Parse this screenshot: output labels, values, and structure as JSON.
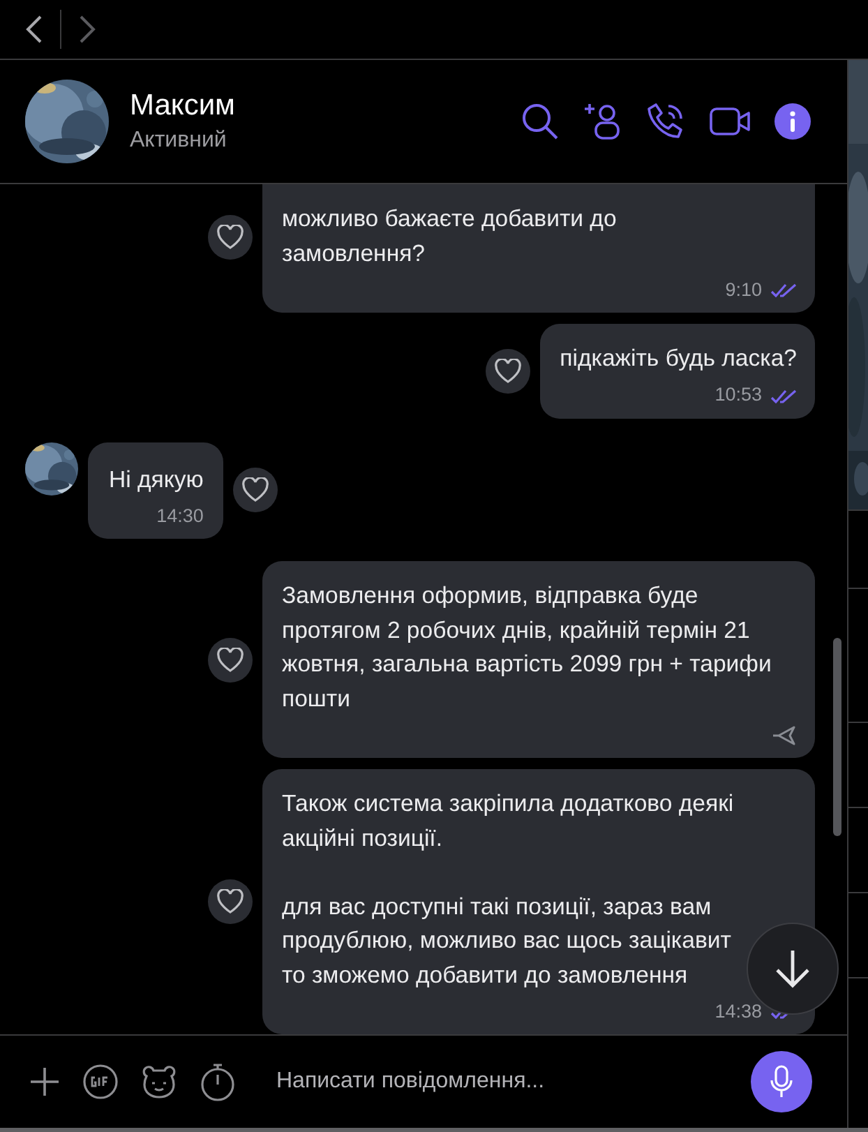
{
  "nav": [
    {
      "kind": "back",
      "disabled": false
    },
    {
      "kind": "forward",
      "disabled": true
    }
  ],
  "contact": {
    "name": "Максим",
    "status": "Активний"
  },
  "messages": [
    {
      "kind": "outgoing",
      "text": "можливо бажаєте добавити до\nзамовлення?",
      "time": "9:10",
      "read": true
    },
    {
      "kind": "outgoing",
      "text": "підкажіть будь ласка?",
      "time": "10:53",
      "read": true
    },
    {
      "kind": "incoming",
      "text": "Ні дякую",
      "time": "14:30"
    },
    {
      "kind": "outgoing",
      "text": "Замовлення оформив, відправка буде\nпротягом 2 робочих днів, крайній термін 21\nжовтня, загальна вартість 2099 грн + тарифи\nпошти",
      "read": false
    },
    {
      "kind": "outgoing",
      "text": "Також система закріпила додатково деякі\nакційні позиції.\n\nдля вас доступні такі позиції, зараз вам\nпродублюю, можливо вас щось зацікавит\nто зможемо добавити до замовлення",
      "time": "14:38",
      "read": true
    }
  ],
  "composer": {
    "placeholder": "Написати повідомлення..."
  }
}
